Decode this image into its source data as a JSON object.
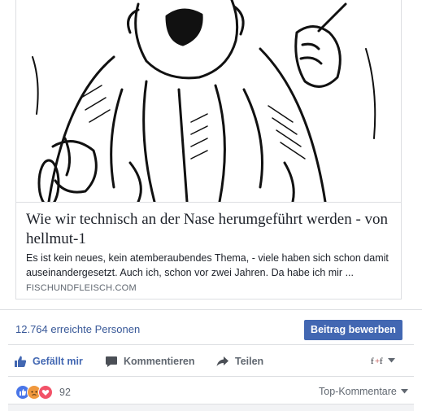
{
  "link_preview": {
    "title": "Wie wir technisch an der Nase herumgeführt werden - von hellmut-1",
    "description": "Es ist kein neues, kein atemberaubendes Thema, - viele haben sich schon damit auseinandergesetzt. Auch ich, schon vor zwei Jahren. Da habe ich mir ...",
    "domain": "FISCHUNDFLEISCH.COM"
  },
  "insights": {
    "reach_text": "12.764 erreichte Personen",
    "promote_label": "Beitrag bewerben"
  },
  "actions": {
    "like_label": "Gefällt mir",
    "comment_label": "Kommentieren",
    "share_label": "Teilen"
  },
  "reactions": {
    "count": "92",
    "types": [
      "like",
      "angry",
      "love"
    ]
  },
  "comments": {
    "sort_label": "Top-Kommentare"
  },
  "colors": {
    "accent": "#4267b2",
    "link": "#385898",
    "muted": "#606770"
  }
}
